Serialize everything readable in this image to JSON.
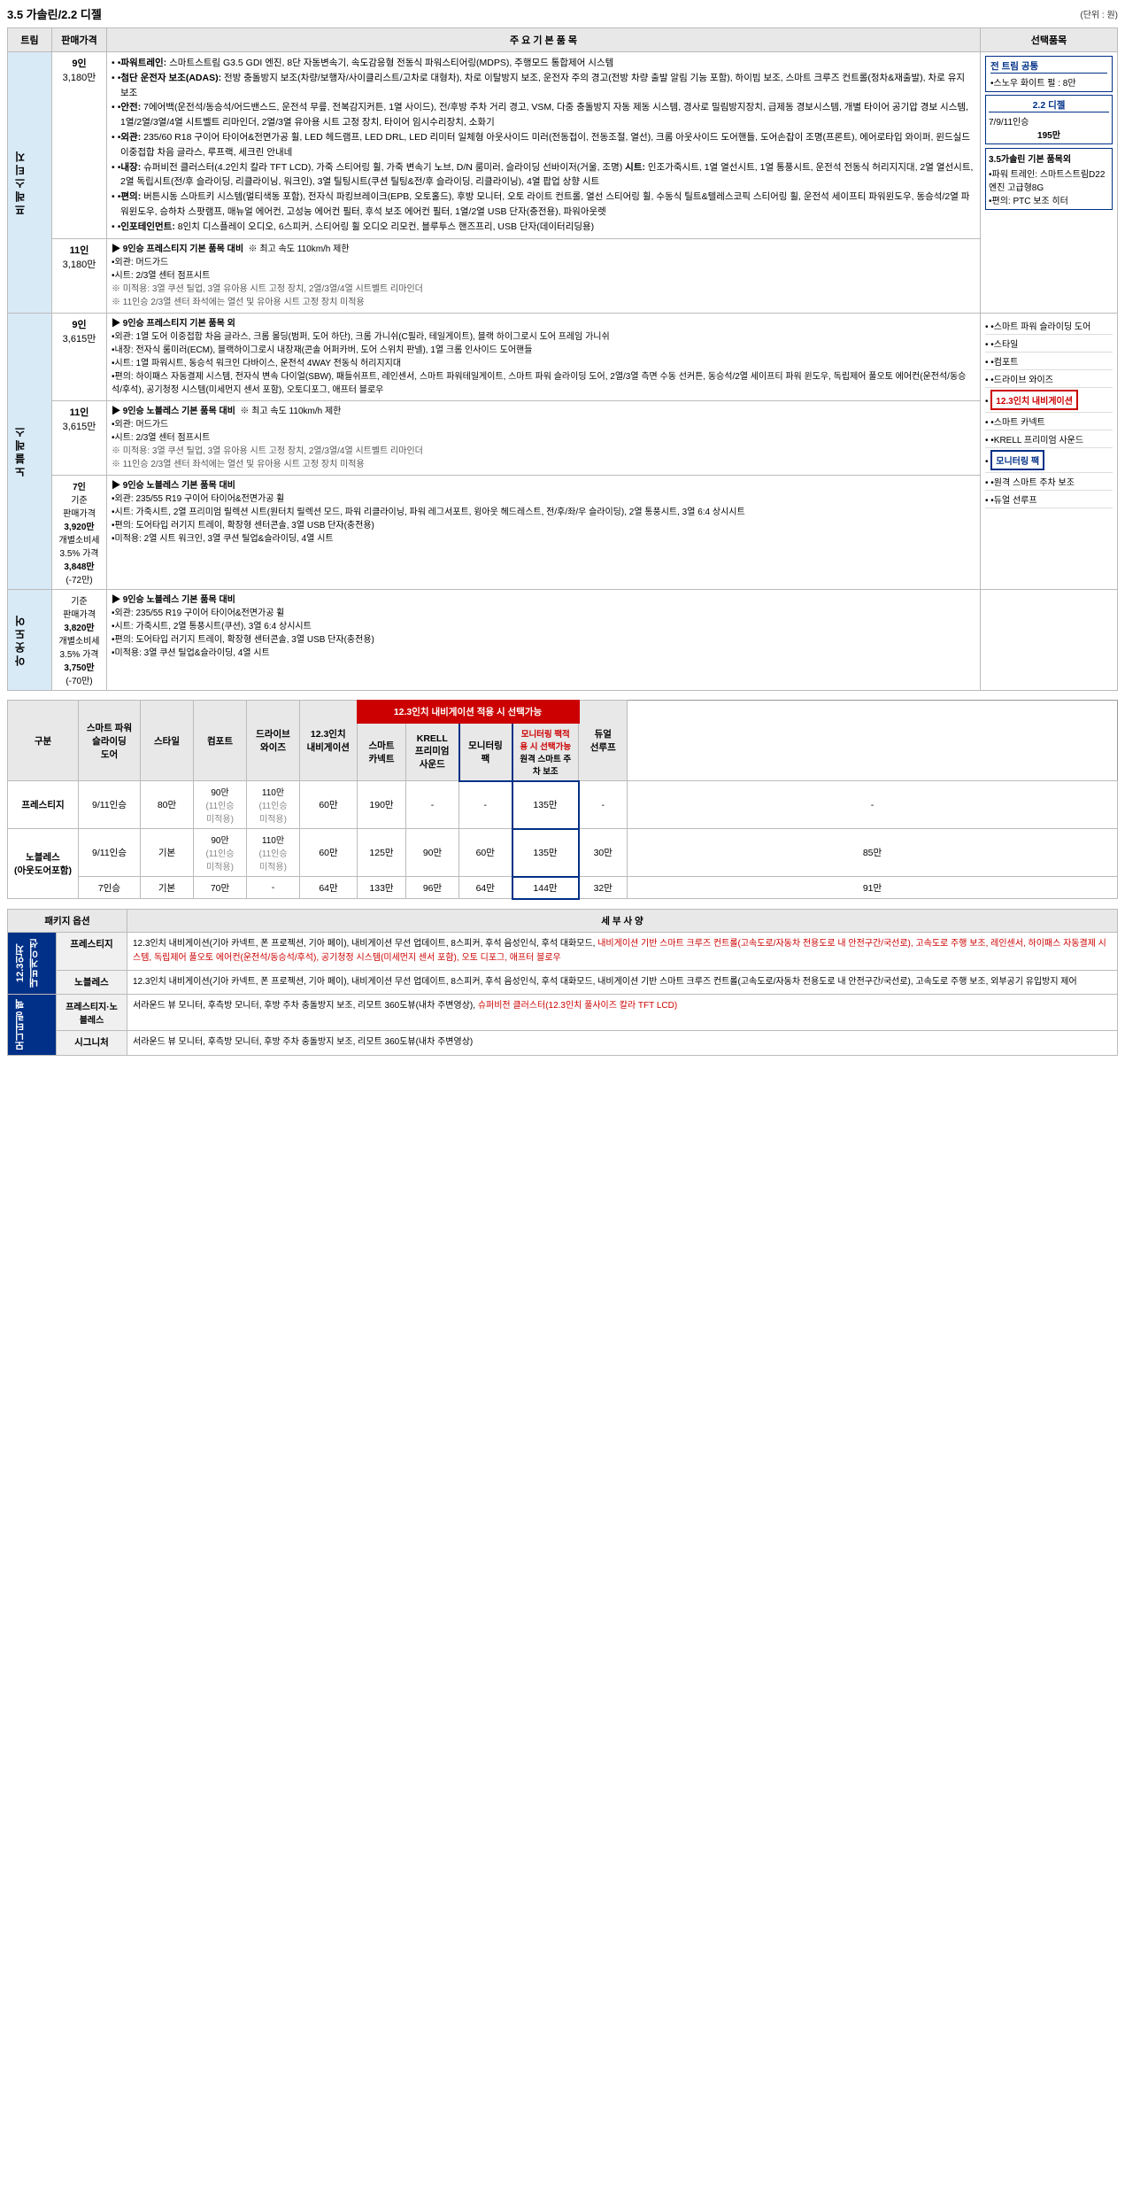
{
  "title": "3.5 가솔린/2.2 디젤",
  "unit": "(단위 : 원)",
  "table_headers": {
    "trim": "트림",
    "price": "판매가격",
    "main": "주 요 기 본 품 목",
    "options": "선택품목"
  },
  "right_options": {
    "common": {
      "title": "전 트림 공통",
      "items": [
        "스노우 화이트 펄 : 8만"
      ]
    },
    "diesel_22": {
      "title": "2.2 디젤",
      "items": [
        "7/9/11인승",
        "195만"
      ]
    },
    "gasoline_35": {
      "label_prefix": "3.5가솔린 기본 품목외",
      "items": [
        "파워 트레인: 스마트스트림D22엔진 고급형8G",
        "편의: PTC 보조 히터"
      ]
    }
  },
  "trims": [
    {
      "name": "프 레 스 티 지",
      "rows": [
        {
          "seats": "9인",
          "price": "3,180만",
          "features": [
            "파워트레인: 스마트스트림 G3.5 GDI 엔진, 8단 자동변속기, 속도감응형 전동식 파워스티어링(MDPS), 주행모드 통합제어 시스템",
            "첨단 운전자 보조(ADAS): 전방 충돌방지 보조(차량/보행자/사이클리스트/고차로 대형차), 차로 이탈방지 보조, 운전자 주의 경고(전방 차량 출발 알림 기능 포함), 하이빔 보조, 스마트 크루즈 컨트롤(정차&재출발), 차로 유지 보조",
            "안전: 7에어백(운전석/동승석/어드밴스드, 운전석 무릎, 전복감지커튼, 1열 사이드), 전/후방 주차 거리 경고, VSM, 다중 충돌방지 자동 제동 시스템, 경사로 밀림방지장치, 급제동 경보시스템, 개별 타이어 공기압 경보 시스템, 1열/2열/3열/4열 시트벨트 리마인더, 2열/3열 유아용 시트 고정 장치, 타이어 임시수리장치, 소화기",
            "외관: 235/60 R18 구이어 타이어&전면가공 휠, LED 헤드램프, LED DRL, LED 리미터 일체형 아웃사이드 미러(전동접이, 전동조절, 열선), 크롬 아웃사이드 도어핸들, 도어손잡이 조명(프론트), 에어로타입 와이퍼, 윈드실드 이중접합 차음 글라스, 루프랙, 세크린 안내네",
            "내장: 슈퍼비전 클러스터(4.2인치 칼라 TFT LCD), 가죽 스티어링 휠, 가죽 변속기 노브, D/N 룸미러, 슬라이딩 선바이저(거울, 조명) 시트: 인조가죽시트, 1열 열선시트, 1열 통풍시트, 운전석 전동식 허리지지대, 2열 열선시트, 2열 독립시트(전/후 슬라이딩, 리클라이닝, 워크인), 3열 틸팅시트(쿠션 틸팅&전/후 슬라이딩, 리클라이닝), 4열 팝업 상향 시트",
            "편의: 버튼시동 스마트키 시스템(멀티색동 포함), 전자식 파킹브레이크(EPB, 오토홀드), 후방 모니터, 오토 라이트 컨트롤, 열선 스티어링 휠, 수동식 틸트&텔레스코픽 스티어링 휠, 운전석 세이프티 파워윈도우, 동승석/2열 파워윈도우, 승하차 스팟램프, 매뉴얼 에어컨, 고성능 에어컨 필터, 후석 보조 에어컨 필터, 1열/2열 USB 단자(충전용), 파워아웃렛",
            "인포테인먼트: 8인치 디스플레이 오디오, 6스피커, 스티어링 휠 오디오 리모컨, 블루투스 핸즈프리, USB 단자(데이터리딩용)"
          ]
        },
        {
          "seats": "11인",
          "price": "3,180만",
          "features": [
            "▶ 9인승 프레스티지 기본 품목 대비  ※ 최고 속도 110km/h 제한",
            "•외관: 머드가드",
            "•시트: 2/3열 센터 점프시트",
            "※ 미적용: 3열 쿠션 틸업, 3열 유아용 시트 고정 장치, 2열/3열/4열 시트벨트 리마인더",
            "※ 11인승 2/3열 센터 좌석에는 열선 및 유아용 시트 고정 장치 미적용"
          ],
          "right_options_items": [
            "스마트 파워 슬라이딩 도어",
            "스타일",
            "컴포트",
            "드라이브 와이즈",
            "12.3인치 내비게이션",
            "스마트 카넥트",
            "KRELL 프리미엄 사운드",
            "모니터링 팩",
            "원격 스마트 주차 보조",
            "듀얼 선루프"
          ]
        }
      ]
    },
    {
      "name": "노 블 레 스",
      "rows": [
        {
          "seats": "9인",
          "price": "3,615만",
          "features": [
            "▶ 9인승 프레스티지 기본 품목 외",
            "•외관: 1열 도어 이중접합 차음 글라스, 크롬 몰딩(범퍼, 도어 하단), 크롬 가니쉬(C필라, 테일게이트), 블랙 하이그로시 도어 프레임 가니쉬",
            "•내장: 전자식 룸미러(ECM), 블랙하이그로시 내장재(콘솔 어퍼카버, 도어 스위치 판넬), 1열 크롬 인사이드 도어핸들",
            "•시트: 1열 파워시트, 동승석 워크인 다바이스, 운전석 4WAY 전동식 허리지지대",
            "•편의: 하이패스 자동결제 시스템, 전자식 변속 다이얼(SBW), 패들쉬프트, 레인센서, 스마트 파워테일게이트, 스마트 파워 슬라이딩 도어, 2열/3열 측면 수동 선커튼, 동승석/2열 세이프티 파워 윈도우, 독립제어 풀오토 에어컨(운전석/동승석/후석), 공기청정 시스템(미세먼지 센서 포함), 오토디포그, 애프터 블로우"
          ]
        },
        {
          "seats": "11인",
          "price": "3,615만",
          "features": [
            "▶ 9인승 노블레스 기본 품목 대비  ※ 최고 속도 110km/h 제한",
            "•외관: 머드가드",
            "•시트: 2/3열 센터 점프시트",
            "※ 미적용: 3열 쿠션 틸업, 3열 유아용 시트 고정 장치, 2열/3열/4열 시트벨트 리마인더",
            "※ 11인승 2/3열 센터 좌석에는 열선 및 유아용 시트 고정 장치 미적용"
          ]
        },
        {
          "seats": "7인",
          "price_label": "기준\n판매가격\n3,920만\n개별소비세\n3.5% 가격\n3,848만\n(-72만)",
          "features": [
            "▶ 9인승 노블레스 기본 품목 대비",
            "•외관: 235/55 R19 구이어 타이어&전면가공 휠",
            "•시트: 가죽시트, 2열 프리미엄 릴렉션 시트(원터치 릴렉션 모드, 파워 리클라이닝, 파워 레그서포트, 윙아웃 헤드레스트, 전/후/좌/우 슬라이딩), 2열 통풍시트, 3열 6:4 상시시트",
            "•편의: 도어타입 러기지 트레이, 확장형 센터콘솔, 3열 USB 단자(충전용)",
            "•미적용: 2열 시트 워크인, 3열 쿠션 틸업&슬라이딩, 4열 시트"
          ]
        }
      ]
    },
    {
      "name": "아 웃 도 어",
      "rows": [
        {
          "seats": "아웃도어",
          "price_label": "기준\n판매가격\n3,820만\n개별소비세\n3.5% 가격\n3,750만\n(-70만)",
          "features": [
            "▶ 9인승 노블레스 기본 품목 대비",
            "•외관: 235/55 R19 구이어 타이어&전면가공 휠",
            "•시트: 가죽시트, 2열 통풍시트(쿠션), 3열 6:4 상시시트",
            "•편의: 도어타입 러기지 트레이, 확장형 센터콘솔, 3열 USB 단자(충전용)",
            "•미적용: 3열 쿠션 틸업&슬라이딩, 4열 시트"
          ]
        }
      ]
    }
  ],
  "price_table": {
    "title": "12.3인치 내비게이션 적용 시 선택가능",
    "headers": {
      "category": "구분",
      "smart_power": "스마트 파워\n슬라이딩\n도어",
      "style": "스타일",
      "comfort": "컴포트",
      "drive_wise": "드라이브\n와이즈",
      "navi_123": "12.3인치\n내비게이션",
      "smart_connect": "스마트\n카넥트",
      "krell": "KRELL\n프리미엄\n사운드",
      "monitoring": "모니터링 팩",
      "remote_park": "원격 스마트 주차 보조",
      "dual_sunroof": "듀얼\n선루프"
    },
    "rows": [
      {
        "trim": "프레스티지",
        "seats": "9/11인승",
        "smart_power": "80만",
        "style": "90만\n(11인승\n미적용)",
        "comfort": "110만\n(11인승\n미적용)",
        "drive_wise": "60만",
        "navi": "190만",
        "smart_connect": "-",
        "krell": "-",
        "monitoring": "135만",
        "remote_park": "-",
        "dual_sunroof": "-"
      },
      {
        "trim": "노블레스\n(아웃도어포함)",
        "seats": "9/11인승",
        "smart_power": "기본",
        "style": "90만\n(11인승\n미적용)",
        "comfort": "110만\n(11인승\n미적용)",
        "drive_wise": "60만",
        "navi": "125만",
        "smart_connect": "90만",
        "krell": "60만",
        "monitoring": "135만",
        "remote_park": "30만",
        "dual_sunroof": "85만"
      },
      {
        "trim": "노블레스\n(아웃도어포함)",
        "seats": "7인승",
        "smart_power": "기본",
        "style": "70만",
        "comfort": "-",
        "drive_wise": "64만",
        "navi": "133만",
        "smart_connect": "96만",
        "krell": "64만",
        "monitoring": "144만",
        "remote_park": "32만",
        "dual_sunroof": "91만"
      }
    ]
  },
  "package_table": {
    "headers": {
      "pkg_option": "패키지 옵션",
      "detail": "세 부 사 양"
    },
    "rows": [
      {
        "pkg_name": "12.3인치\n내비게이션",
        "trim": "프레스티지",
        "detail": "12.3인치 내비게이션(기아 카넥트, 폰 프로젝션, 기아 페이), 내비게이션 무선 업데이트, 8스피커, 후석 음성인식, 후석 대화모드, 내비게이션 기반 스마트 크루즈 컨트롤(고속도로/자동차 전용도로 내 안전구간/국선로), 고속도로 주행 보조, 레인센서, 하이패스 자동결제 시스템, 독립제어 풀오토 에어컨(운전석/동승석/후석), 공기청정 시스템(미세먼지 센서 포함), 오토 디포그, 애프터 블로우",
        "is_red": true
      },
      {
        "pkg_name": "12.3인치\n내비게이션",
        "trim": "노블레스",
        "detail": "12.3인치 내비게이션(기아 카넥트, 폰 프로젝션, 기아 페이), 내비게이션 무선 업데이트, 8스피커, 후석 음성인식, 후석 대화모드, 내비게이션 기반 스마트 크루즈 컨트롤(고속도로/자동차 전용도로 내 안전구간/국선로), 고속도로 주행 보조, 외부공기 유입방지 제어",
        "is_red": false
      },
      {
        "pkg_name": "모니터링 팩",
        "trim": "프레스티지·노블레스",
        "detail": "서라운드 뷰 모니터, 후측방 모니터, 후방 주차 충돌방지 보조, 리모트 360도뷰(내차 주변영상), 슈퍼비전 클러스터(12.3인치 풀사이즈 칼라 TFT LCD)",
        "is_red": true
      },
      {
        "pkg_name": "모니터링 팩",
        "trim": "시그니처",
        "detail": "서라운드 뷰 모니터, 후측방 모니터, 후방 주차 충돌방지 보조, 리모트 360도뷰(내차 주변영상)",
        "is_red": false
      }
    ]
  }
}
